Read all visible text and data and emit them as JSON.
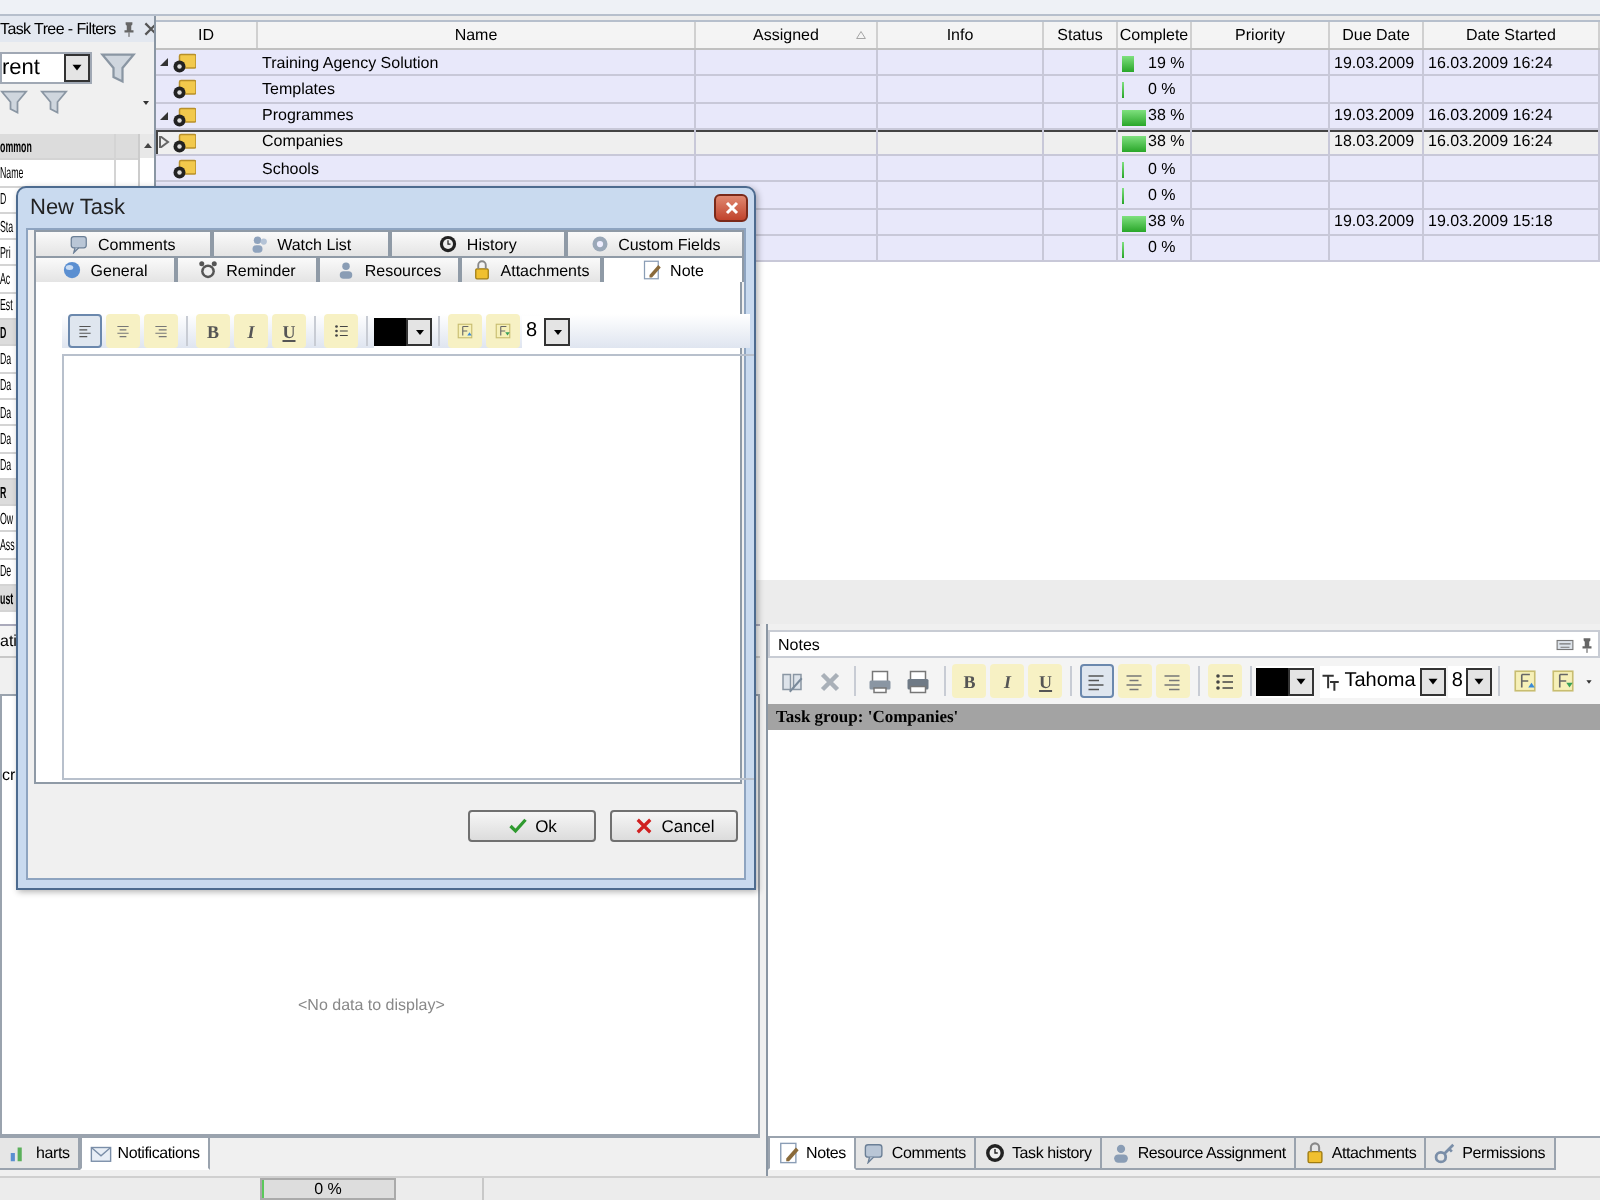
{
  "tree_panel": {
    "title": "Task Tree - Filters",
    "filter": {
      "value": "rent"
    },
    "properties": [
      {
        "kind": "category",
        "text": "ommon"
      },
      {
        "kind": "property",
        "text": "Name"
      },
      {
        "kind": "property",
        "text": "D"
      },
      {
        "kind": "property",
        "text": "Sta"
      },
      {
        "kind": "property",
        "text": "Pri"
      },
      {
        "kind": "property",
        "text": "Ac"
      },
      {
        "kind": "property",
        "text": "Est"
      },
      {
        "kind": "category",
        "text": "D"
      },
      {
        "kind": "property",
        "text": "Da"
      },
      {
        "kind": "property",
        "text": "Da"
      },
      {
        "kind": "property",
        "text": "Da"
      },
      {
        "kind": "property",
        "text": "Da"
      },
      {
        "kind": "property",
        "text": "Da"
      },
      {
        "kind": "category",
        "text": "R"
      },
      {
        "kind": "property",
        "text": "Ow"
      },
      {
        "kind": "property",
        "text": "Ass"
      },
      {
        "kind": "property",
        "text": "De"
      },
      {
        "kind": "category",
        "text": "ust"
      }
    ]
  },
  "task_grid": {
    "columns": [
      {
        "label": "ID",
        "sorted": false
      },
      {
        "label": "Name",
        "sorted": false
      },
      {
        "label": "Assigned",
        "sorted": true
      },
      {
        "label": "Info",
        "sorted": false
      },
      {
        "label": "Status",
        "sorted": false
      },
      {
        "label": "Complete",
        "sorted": false
      },
      {
        "label": "Priority",
        "sorted": false
      },
      {
        "label": "Due Date",
        "sorted": false
      },
      {
        "label": "Date Started",
        "sorted": false
      }
    ],
    "rows": [
      {
        "name": "Training Agency Solution",
        "expanded": true,
        "selected": false,
        "complete": "19 %",
        "level": 0.19,
        "due": "19.03.2009",
        "started": "16.03.2009 16:24",
        "children": [
          {
            "name": "Templates",
            "selected": false,
            "complete": "0 %",
            "level": 0
          },
          {
            "name": "Programmes",
            "expanded": true,
            "selected": false,
            "complete": "38 %",
            "level": 0.38,
            "due": "19.03.2009",
            "started": "16.03.2009 16:24",
            "children": [
              {
                "name": "Companies",
                "expanded": false,
                "selected": true,
                "complete": "38 %",
                "level": 0.38,
                "due": "18.03.2009",
                "started": "16.03.2009 16:24"
              },
              {
                "name": "Schools",
                "selected": false,
                "complete": "0 %",
                "level": 0
              },
              {
                "selected": false,
                "complete": "0 %",
                "level": 0
              },
              {
                "selected": false,
                "complete": "38 %",
                "level": 0.38,
                "due": "19.03.2009",
                "started": "19.03.2009 15:18"
              },
              {
                "selected": false,
                "complete": "0 %",
                "level": 0
              }
            ]
          }
        ]
      }
    ]
  },
  "lower_left": {
    "title": "ati",
    "fragment": "cr",
    "empty_text": "<No data to display>",
    "tabs": [
      {
        "label": "harts",
        "kind": "chart",
        "selected": false
      },
      {
        "label": "Notifications",
        "kind": "envelope",
        "selected": true
      }
    ]
  },
  "notes_panel": {
    "title": "Notes",
    "font": "Tahoma",
    "size": "8",
    "header": "Task group: 'Companies'",
    "toolbar": [
      {
        "kind": "spell",
        "selected": false
      },
      {
        "kind": "delete",
        "selected": false
      },
      {
        "kind": "preview",
        "selected": false
      },
      {
        "kind": "print",
        "selected": false
      },
      {
        "kind": "bold",
        "label": "B",
        "selected": false
      },
      {
        "kind": "italic",
        "label": "I",
        "selected": false
      },
      {
        "kind": "underline",
        "label": "U",
        "selected": false
      },
      {
        "kind": "align-left",
        "selected": true
      },
      {
        "kind": "align-center",
        "selected": false
      },
      {
        "kind": "align-right",
        "selected": false
      },
      {
        "kind": "bullets",
        "selected": false
      }
    ],
    "tabs": [
      {
        "label": "Notes",
        "kind": "note",
        "selected": true
      },
      {
        "label": "Comments",
        "kind": "comment",
        "selected": false
      },
      {
        "label": "Task history",
        "kind": "clock",
        "selected": false
      },
      {
        "label": "Resource Assignment",
        "kind": "person",
        "selected": false
      },
      {
        "label": "Attachments",
        "kind": "lock",
        "selected": false
      },
      {
        "label": "Permissions",
        "kind": "key",
        "selected": false
      }
    ]
  },
  "dialog": {
    "title": "New Task",
    "size": "8",
    "tabs_top": [
      {
        "label": "Comments",
        "kind": "comment",
        "selected": false
      },
      {
        "label": "Watch List",
        "kind": "people",
        "selected": false
      },
      {
        "label": "History",
        "kind": "clock",
        "selected": false
      },
      {
        "label": "Custom Fields",
        "kind": "gear",
        "selected": false
      }
    ],
    "tabs_bottom": [
      {
        "label": "General",
        "kind": "globe",
        "selected": false
      },
      {
        "label": "Reminder",
        "kind": "alarm",
        "selected": false
      },
      {
        "label": "Resources",
        "kind": "person",
        "selected": false
      },
      {
        "label": "Attachments",
        "kind": "lock",
        "selected": false
      },
      {
        "label": "Note",
        "kind": "note",
        "selected": true
      }
    ],
    "toolbar": [
      {
        "kind": "align-left",
        "selected": true
      },
      {
        "kind": "align-center",
        "selected": false
      },
      {
        "kind": "align-right",
        "selected": false
      },
      {
        "kind": "bold",
        "label": "B",
        "selected": false
      },
      {
        "kind": "italic",
        "label": "I",
        "selected": false
      },
      {
        "kind": "underline",
        "label": "U",
        "selected": false
      },
      {
        "kind": "bullets",
        "selected": false
      }
    ],
    "buttons": [
      {
        "label": "Ok",
        "kind": "ok"
      },
      {
        "label": "Cancel",
        "kind": "cancel"
      }
    ]
  },
  "status_bar": {
    "progress": {
      "text": "0 %",
      "level": 0
    }
  }
}
